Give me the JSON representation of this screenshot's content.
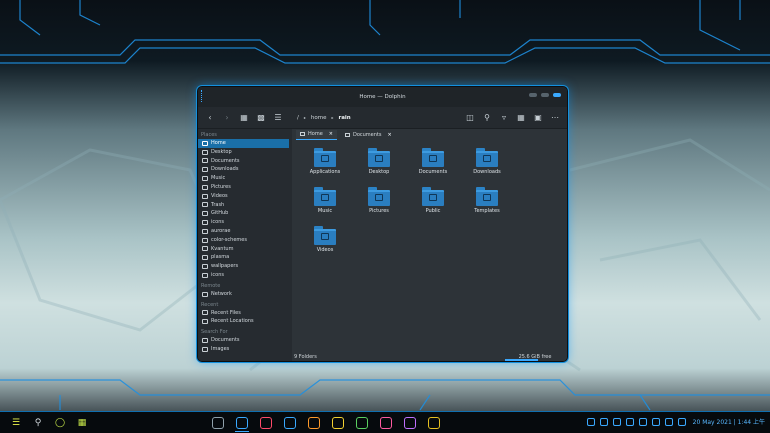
{
  "window": {
    "title": "Home — Dolphin"
  },
  "toolbar": {
    "back_icon": "arrow-left-icon",
    "forward_icon": "arrow-right-icon",
    "breadcrumb": [
      "/",
      "home",
      "rain"
    ],
    "view_icons": [
      "icons-view",
      "compact-view",
      "details-view"
    ],
    "right_icons": [
      "split-icon",
      "search-icon",
      "filter-icon",
      "grid-icon",
      "preview-icon",
      "menu-icon"
    ]
  },
  "sidebar": {
    "places_title": "Places",
    "places": [
      {
        "label": "Home",
        "icon": "home-icon",
        "active": true
      },
      {
        "label": "Desktop",
        "icon": "desktop-icon"
      },
      {
        "label": "Documents",
        "icon": "documents-icon"
      },
      {
        "label": "Downloads",
        "icon": "downloads-icon"
      },
      {
        "label": "Music",
        "icon": "music-icon"
      },
      {
        "label": "Pictures",
        "icon": "pictures-icon"
      },
      {
        "label": "Videos",
        "icon": "videos-icon"
      },
      {
        "label": "Trash",
        "icon": "trash-icon"
      },
      {
        "label": "GitHub",
        "icon": "folder-icon"
      },
      {
        "label": "icons",
        "icon": "folder-icon"
      },
      {
        "label": "aurorae",
        "icon": "folder-icon"
      },
      {
        "label": "color-schemes",
        "icon": "folder-icon"
      },
      {
        "label": "Kvantum",
        "icon": "folder-icon"
      },
      {
        "label": "plasma",
        "icon": "folder-icon"
      },
      {
        "label": "wallpapers",
        "icon": "folder-icon"
      },
      {
        "label": "icons",
        "icon": "folder-icon"
      }
    ],
    "remote_title": "Remote",
    "remote": [
      {
        "label": "Network",
        "icon": "network-icon"
      }
    ],
    "recent_title": "Recent",
    "recent": [
      {
        "label": "Recent Files",
        "icon": "recent-files-icon"
      },
      {
        "label": "Recent Locations",
        "icon": "recent-locations-icon"
      }
    ],
    "search_title": "Search For",
    "search": [
      {
        "label": "Documents",
        "icon": "documents-icon"
      },
      {
        "label": "Images",
        "icon": "images-icon"
      }
    ]
  },
  "tabs": [
    {
      "label": "Home",
      "active": true
    },
    {
      "label": "Documents",
      "active": false
    }
  ],
  "folders": [
    {
      "label": "Applications",
      "icon": "applications-folder-icon"
    },
    {
      "label": "Desktop",
      "icon": "desktop-folder-icon"
    },
    {
      "label": "Documents",
      "icon": "documents-folder-icon"
    },
    {
      "label": "Downloads",
      "icon": "downloads-folder-icon"
    },
    {
      "label": "Music",
      "icon": "music-folder-icon"
    },
    {
      "label": "Pictures",
      "icon": "pictures-folder-icon"
    },
    {
      "label": "Public",
      "icon": "public-folder-icon"
    },
    {
      "label": "Templates",
      "icon": "templates-folder-icon"
    },
    {
      "label": "Videos",
      "icon": "videos-folder-icon"
    }
  ],
  "status": {
    "count": "9 Folders",
    "free": "25.6 GiB free",
    "used_fraction": 0.55
  },
  "taskbar": {
    "clock": "20 May 2021 | 1:44 上午",
    "launchers": [
      "launcher-icon",
      "search-icon",
      "circle-app-icon",
      "chip-icon"
    ],
    "apps": [
      "settings-app",
      "dolphin-app",
      "app-red",
      "app-blue",
      "app-orange",
      "app-yellow",
      "app-green",
      "app-pink",
      "app-purple",
      "app-gold"
    ],
    "tray": [
      "tray-1",
      "tray-2",
      "tray-3",
      "tray-4",
      "tray-5",
      "tray-6",
      "tray-7",
      "tray-8"
    ]
  },
  "colors": {
    "accent": "#3aa9ff",
    "selection": "#1a6fa8",
    "folder": "#2a7ec0"
  }
}
